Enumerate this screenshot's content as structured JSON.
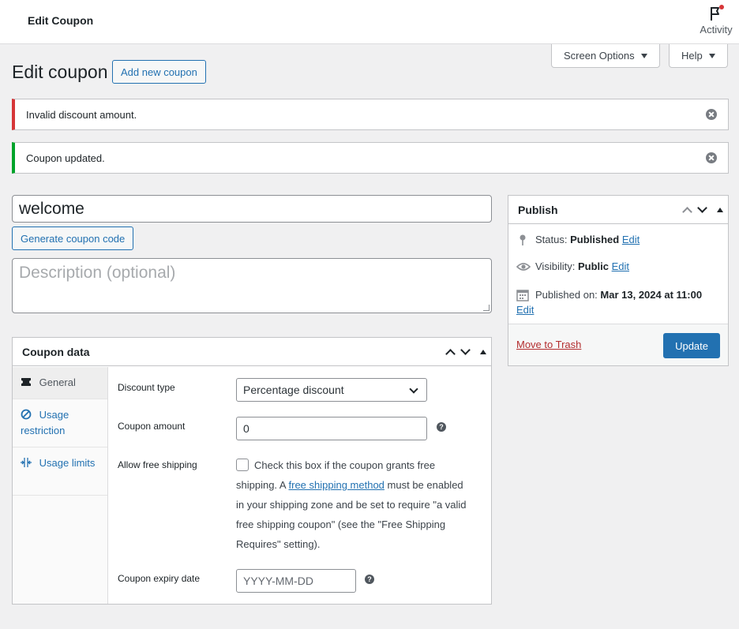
{
  "topbar": {
    "title": "Edit Coupon",
    "activity_label": "Activity",
    "activity_icon": "flag-icon"
  },
  "screen_options": {
    "label": "Screen Options"
  },
  "help": {
    "label": "Help"
  },
  "page": {
    "heading": "Edit coupon",
    "add_new_label": "Add new coupon"
  },
  "notices": {
    "error": {
      "text": "Invalid discount amount.",
      "color": "#d63638"
    },
    "success": {
      "text": "Coupon updated.",
      "color": "#00a32a"
    }
  },
  "coupon": {
    "code": "welcome",
    "generate_label": "Generate coupon code",
    "description_placeholder": "Description (optional)"
  },
  "publish": {
    "title": "Publish",
    "status_label": "Status:",
    "status_value": "Published",
    "visibility_label": "Visibility:",
    "visibility_value": "Public",
    "published_label": "Published on:",
    "published_value": "Mar 13, 2024 at 11:00",
    "edit_label": "Edit",
    "trash_label": "Move to Trash",
    "update_label": "Update",
    "accent": "#2271b1"
  },
  "coupon_data": {
    "title": "Coupon data",
    "tabs": [
      {
        "label": "General",
        "icon": "ticket-icon"
      },
      {
        "label": "Usage restriction",
        "icon": "block-icon"
      },
      {
        "label": "Usage limits",
        "icon": "limits-icon"
      }
    ],
    "fields": {
      "discount_type_label": "Discount type",
      "discount_type_value": "Percentage discount",
      "amount_label": "Coupon amount",
      "amount_value": "0",
      "free_shipping_label": "Allow free shipping",
      "free_shipping_text_1": "Check this box if the coupon grants free shipping. A ",
      "free_shipping_link": "free shipping method",
      "free_shipping_text_2": " must be enabled in your shipping zone and be set to require \"a valid free shipping coupon\" (see the \"Free Shipping Requires\" setting).",
      "expiry_label": "Coupon expiry date",
      "expiry_placeholder": "YYYY-MM-DD"
    }
  }
}
